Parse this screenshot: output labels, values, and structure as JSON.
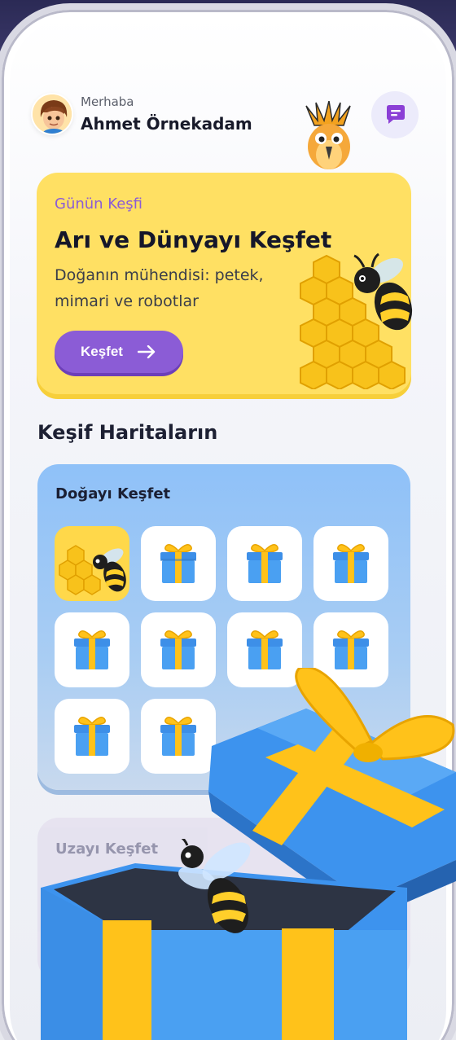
{
  "header": {
    "greeting": "Merhaba",
    "user_name": "Ahmet Örnekadam",
    "chat_icon": "chat-bubble-icon"
  },
  "hero": {
    "kicker": "Günün Keşfi",
    "title": "Arı ve Dünyayı Keşfet",
    "description": "Doğanın mühendisi: petek, mimari ve robotlar",
    "button_label": "Keşfet",
    "button_icon": "arrow-right-icon"
  },
  "section": {
    "title": "Keşif Haritaların"
  },
  "maps": [
    {
      "title": "Doğayı Keşfet",
      "tiles": [
        {
          "state": "unlocked",
          "icon": "bee-honeycomb-icon"
        },
        {
          "state": "locked",
          "icon": "gift-icon"
        },
        {
          "state": "locked",
          "icon": "gift-icon"
        },
        {
          "state": "locked",
          "icon": "gift-icon"
        },
        {
          "state": "locked",
          "icon": "gift-icon"
        },
        {
          "state": "locked",
          "icon": "gift-icon"
        },
        {
          "state": "locked",
          "icon": "gift-icon"
        },
        {
          "state": "locked",
          "icon": "gift-icon"
        },
        {
          "state": "locked",
          "icon": "gift-icon"
        },
        {
          "state": "locked",
          "icon": "gift-icon"
        }
      ]
    },
    {
      "title": "Uzayı Keşfet"
    }
  ],
  "colors": {
    "accent": "#8b5cd6",
    "hero_bg": "#ffe063",
    "map_bg": "#8fc1f8"
  }
}
